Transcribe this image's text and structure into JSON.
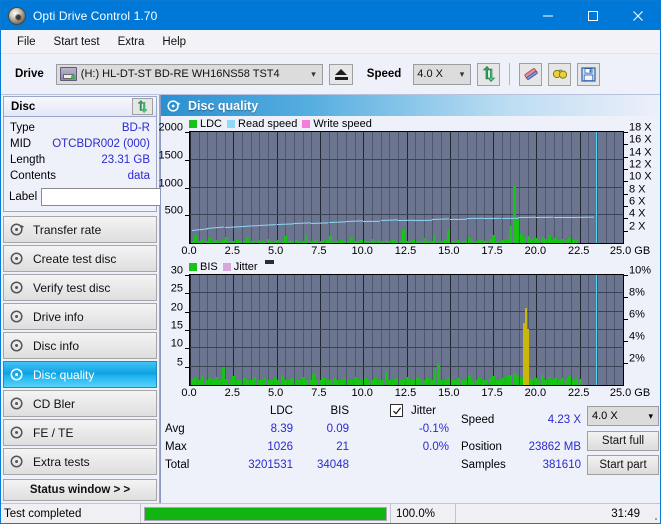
{
  "window": {
    "title": "Opti Drive Control 1.70",
    "minimize": "minimize-icon",
    "maximize": "maximize-icon",
    "close": "close-icon"
  },
  "menubar": {
    "items": [
      "File",
      "Start test",
      "Extra",
      "Help"
    ]
  },
  "toolbar": {
    "drive_label": "Drive",
    "drive_value": "(H:)   HL-DT-ST BD-RE  WH16NS58 TST4",
    "eject": "eject-button",
    "speed_label": "Speed",
    "speed_value": "4.0 X",
    "refresh": "refresh-icon",
    "eraser": "eraser-icon",
    "goggles": "goggles-icon",
    "save": "save-icon"
  },
  "sidebar": {
    "disc_panel": {
      "title": "Disc",
      "refresh_button": "refresh-icon",
      "rows": [
        {
          "key": "Type",
          "value": "BD-R"
        },
        {
          "key": "MID",
          "value": "OTCBDR002 (000)"
        },
        {
          "key": "Length",
          "value": "23.31 GB"
        },
        {
          "key": "Contents",
          "value": "data"
        }
      ],
      "label_key": "Label",
      "label_value": "",
      "label_placeholder": "",
      "label_button": "disc-icon"
    },
    "nav": [
      {
        "label": "Transfer rate",
        "active": false
      },
      {
        "label": "Create test disc",
        "active": false
      },
      {
        "label": "Verify test disc",
        "active": false
      },
      {
        "label": "Drive info",
        "active": false
      },
      {
        "label": "Disc info",
        "active": false
      },
      {
        "label": "Disc quality",
        "active": true
      },
      {
        "label": "CD Bler",
        "active": false
      },
      {
        "label": "FE / TE",
        "active": false
      },
      {
        "label": "Extra tests",
        "active": false
      }
    ],
    "status_window_button": "Status window > >"
  },
  "main": {
    "header_title": "Disc quality",
    "header_icon": "disc-quality-icon"
  },
  "stats": {
    "col_ldc": "LDC",
    "col_bis": "BIS",
    "row_avg": "Avg",
    "row_max": "Max",
    "row_total": "Total",
    "avg_ldc": "8.39",
    "avg_bis": "0.09",
    "max_ldc": "1026",
    "max_bis": "21",
    "total_ldc": "3201531",
    "total_bis": "34048",
    "jitter_label": "Jitter",
    "jitter_checked": true,
    "jitter_avg": "-0.1%",
    "jitter_max": "0.0%",
    "speed_label": "Speed",
    "speed_value": "4.23 X",
    "position_label": "Position",
    "position_value": "23862 MB",
    "samples_label": "Samples",
    "samples_value": "381610",
    "speed_select": "4.0 X",
    "start_full": "Start full",
    "start_part": "Start part"
  },
  "statusbar": {
    "message": "Test completed",
    "progress_percent": "100.0%",
    "progress_value": 100,
    "elapsed": "31:49"
  },
  "chart_data": [
    {
      "type": "bar",
      "id": "ldc-chart",
      "title": "",
      "legend": [
        {
          "name": "LDC",
          "color": "#18c318"
        },
        {
          "name": "Read speed",
          "color": "#8fd8f8"
        },
        {
          "name": "Write speed",
          "color": "#f77ce0"
        }
      ],
      "legend_position": "top-left",
      "xlabel": "GB",
      "ylabel": "LDC",
      "xlim": [
        0,
        25
      ],
      "ylim": [
        0,
        2000
      ],
      "y2lim": [
        0,
        18
      ],
      "y2label": "X",
      "xticks": [
        "0.0",
        "2.5",
        "5.0",
        "7.5",
        "10.0",
        "12.5",
        "15.0",
        "17.5",
        "20.0",
        "22.5",
        "25.0 GB"
      ],
      "yticks": [
        500,
        1000,
        1500,
        2000
      ],
      "y2ticks": [
        "2 X",
        "4 X",
        "6 X",
        "8 X",
        "10 X",
        "12 X",
        "14 X",
        "16 X",
        "18 X"
      ],
      "grid": true,
      "series": [
        {
          "name": "LDC",
          "color": "#18c318",
          "x": [
            0.1,
            0.3,
            0.5,
            0.7,
            0.9,
            1.1,
            1.3,
            1.5,
            1.7,
            1.9,
            2.1,
            2.3,
            2.5,
            2.7,
            2.9,
            3.1,
            3.3,
            3.5,
            3.7,
            3.9,
            4.1,
            4.3,
            4.5,
            4.7,
            4.9,
            5.1,
            5.3,
            5.5,
            5.7,
            5.9,
            6.1,
            6.3,
            6.5,
            6.7,
            6.9,
            7.1,
            7.3,
            7.5,
            7.7,
            7.9,
            8.1,
            8.3,
            8.5,
            8.7,
            8.9,
            9.1,
            9.3,
            9.5,
            9.7,
            9.9,
            10.1,
            10.3,
            10.5,
            10.7,
            10.9,
            11.1,
            11.3,
            11.5,
            11.7,
            11.9,
            12.1,
            12.3,
            12.5,
            12.7,
            12.9,
            13.1,
            13.3,
            13.5,
            13.7,
            13.9,
            14.1,
            14.3,
            14.5,
            14.7,
            14.9,
            15.1,
            15.3,
            15.5,
            15.7,
            15.9,
            16.1,
            16.3,
            16.5,
            16.7,
            16.9,
            17.1,
            17.3,
            17.5,
            17.7,
            17.9,
            18.1,
            18.3,
            18.5,
            18.7,
            18.9,
            19.1,
            19.3,
            19.5,
            19.7,
            19.9,
            20.1,
            20.3,
            20.5,
            20.7,
            20.9,
            21.1,
            21.3,
            21.5,
            21.7,
            21.9,
            22.1,
            22.3,
            22.5,
            22.7,
            22.9,
            23.1,
            23.3
          ],
          "values": [
            40,
            130,
            45,
            70,
            40,
            95,
            38,
            50,
            36,
            48,
            110,
            42,
            36,
            60,
            38,
            44,
            95,
            40,
            34,
            52,
            36,
            42,
            80,
            38,
            34,
            48,
            36,
            120,
            40,
            34,
            55,
            38,
            42,
            150,
            38,
            36,
            60,
            40,
            34,
            48,
            120,
            38,
            34,
            50,
            36,
            42,
            90,
            38,
            34,
            46,
            36,
            40,
            70,
            38,
            34,
            44,
            36,
            38,
            60,
            36,
            34,
            230,
            40,
            36,
            48,
            38,
            34,
            90,
            36,
            38,
            140,
            38,
            36,
            50,
            240,
            38,
            34,
            48,
            36,
            38,
            90,
            38,
            34,
            50,
            36,
            38,
            70,
            150,
            38,
            34,
            60,
            80,
            300,
            1026,
            420,
            160,
            90,
            120,
            80,
            95,
            70,
            110,
            65,
            150,
            60,
            90,
            55,
            75,
            60,
            90,
            50,
            70
          ]
        },
        {
          "name": "Read speed",
          "color": "#8fd8f8",
          "type": "line",
          "axis": "y2",
          "x": [
            0.1,
            1.0,
            2.0,
            3.0,
            4.0,
            5.0,
            6.0,
            7.0,
            8.0,
            9.0,
            10.0,
            11.0,
            12.0,
            13.0,
            14.0,
            15.0,
            16.0,
            17.0,
            18.0,
            19.0,
            20.0,
            21.0,
            22.0,
            23.3
          ],
          "values": [
            2.0,
            2.25,
            2.5,
            2.65,
            2.8,
            2.95,
            3.05,
            3.15,
            3.25,
            3.35,
            3.45,
            3.5,
            3.6,
            3.65,
            3.7,
            3.8,
            3.85,
            3.9,
            3.95,
            4.0,
            4.05,
            4.1,
            4.1,
            4.15
          ]
        },
        {
          "name": "Write speed",
          "color": "#f77ce0",
          "x": [],
          "values": []
        }
      ],
      "cursor_x": 23.45
    },
    {
      "type": "bar",
      "id": "bis-chart",
      "title": "",
      "legend": [
        {
          "name": "BIS",
          "color": "#18c318"
        },
        {
          "name": "Jitter",
          "color": "#d6a8dd"
        }
      ],
      "legend_position": "top-left",
      "xlabel": "GB",
      "ylabel": "BIS",
      "xlim": [
        0,
        25
      ],
      "ylim": [
        0,
        30
      ],
      "y2lim": [
        0,
        10
      ],
      "y2label": "%",
      "xticks": [
        "0.0",
        "2.5",
        "5.0",
        "7.5",
        "10.0",
        "12.5",
        "15.0",
        "17.5",
        "20.0",
        "22.5",
        "25.0 GB"
      ],
      "yticks": [
        5,
        10,
        15,
        20,
        25,
        30
      ],
      "y2ticks": [
        "2%",
        "4%",
        "6%",
        "8%",
        "10%"
      ],
      "grid": true,
      "series": [
        {
          "name": "BIS",
          "color": "#18c318",
          "x": [
            0.1,
            0.3,
            0.5,
            0.7,
            0.9,
            1.1,
            1.3,
            1.5,
            1.7,
            1.9,
            2.1,
            2.3,
            2.5,
            2.7,
            2.9,
            3.1,
            3.3,
            3.5,
            3.7,
            3.9,
            4.1,
            4.3,
            4.5,
            4.7,
            4.9,
            5.1,
            5.3,
            5.5,
            5.7,
            5.9,
            6.1,
            6.3,
            6.5,
            6.7,
            6.9,
            7.1,
            7.3,
            7.5,
            7.7,
            7.9,
            8.1,
            8.3,
            8.5,
            8.7,
            8.9,
            9.1,
            9.3,
            9.5,
            9.7,
            9.9,
            10.1,
            10.3,
            10.5,
            10.7,
            10.9,
            11.1,
            11.3,
            11.5,
            11.7,
            11.9,
            12.1,
            12.3,
            12.5,
            12.7,
            12.9,
            13.1,
            13.3,
            13.5,
            13.7,
            13.9,
            14.1,
            14.3,
            14.5,
            14.7,
            14.9,
            15.1,
            15.3,
            15.5,
            15.7,
            15.9,
            16.1,
            16.3,
            16.5,
            16.7,
            16.9,
            17.1,
            17.3,
            17.5,
            17.7,
            17.9,
            18.1,
            18.3,
            18.5,
            18.7,
            18.9,
            19.1,
            19.3,
            19.5,
            19.7,
            19.9,
            20.1,
            20.3,
            20.5,
            20.7,
            20.9,
            21.1,
            21.3,
            21.5,
            21.7,
            21.9,
            22.1,
            22.3,
            22.5,
            22.7,
            22.9,
            23.1,
            23.3
          ],
          "values": [
            1.6,
            2.0,
            1.5,
            2.6,
            1.4,
            1.8,
            1.5,
            2.2,
            1.4,
            4.8,
            1.6,
            1.3,
            2.4,
            1.5,
            1.3,
            2.0,
            1.4,
            1.3,
            2.2,
            1.4,
            1.3,
            1.8,
            1.4,
            1.3,
            2.0,
            1.4,
            2.6,
            1.4,
            1.3,
            1.8,
            1.4,
            1.3,
            2.2,
            1.4,
            1.3,
            3.0,
            1.4,
            1.3,
            2.0,
            1.4,
            1.3,
            1.8,
            1.4,
            1.3,
            2.0,
            1.4,
            1.3,
            2.2,
            1.4,
            1.3,
            1.8,
            1.4,
            1.3,
            2.0,
            1.4,
            1.3,
            3.8,
            1.4,
            1.3,
            1.8,
            1.4,
            1.3,
            2.2,
            1.4,
            1.3,
            2.0,
            1.4,
            1.3,
            1.8,
            1.4,
            4.5,
            5.6,
            1.4,
            1.3,
            2.0,
            1.4,
            1.3,
            1.8,
            1.4,
            1.3,
            2.6,
            1.4,
            1.3,
            2.0,
            1.4,
            1.3,
            1.8,
            2.4,
            1.4,
            1.3,
            2.0,
            2.4,
            2.8,
            3.2,
            2.6,
            1.8,
            1.5,
            2.2,
            1.6,
            2.0,
            1.5,
            2.8,
            1.5,
            2.2,
            1.4,
            2.0,
            1.5,
            1.8,
            1.6,
            2.4,
            1.5,
            2.0,
            1.6
          ]
        },
        {
          "name": "Jitter",
          "color": "#c9b70a",
          "axis": "y2",
          "x": [
            19.3,
            19.4,
            19.5
          ],
          "values": [
            16.8,
            21.0,
            15.2
          ]
        }
      ],
      "cursor_x": 23.45
    }
  ]
}
